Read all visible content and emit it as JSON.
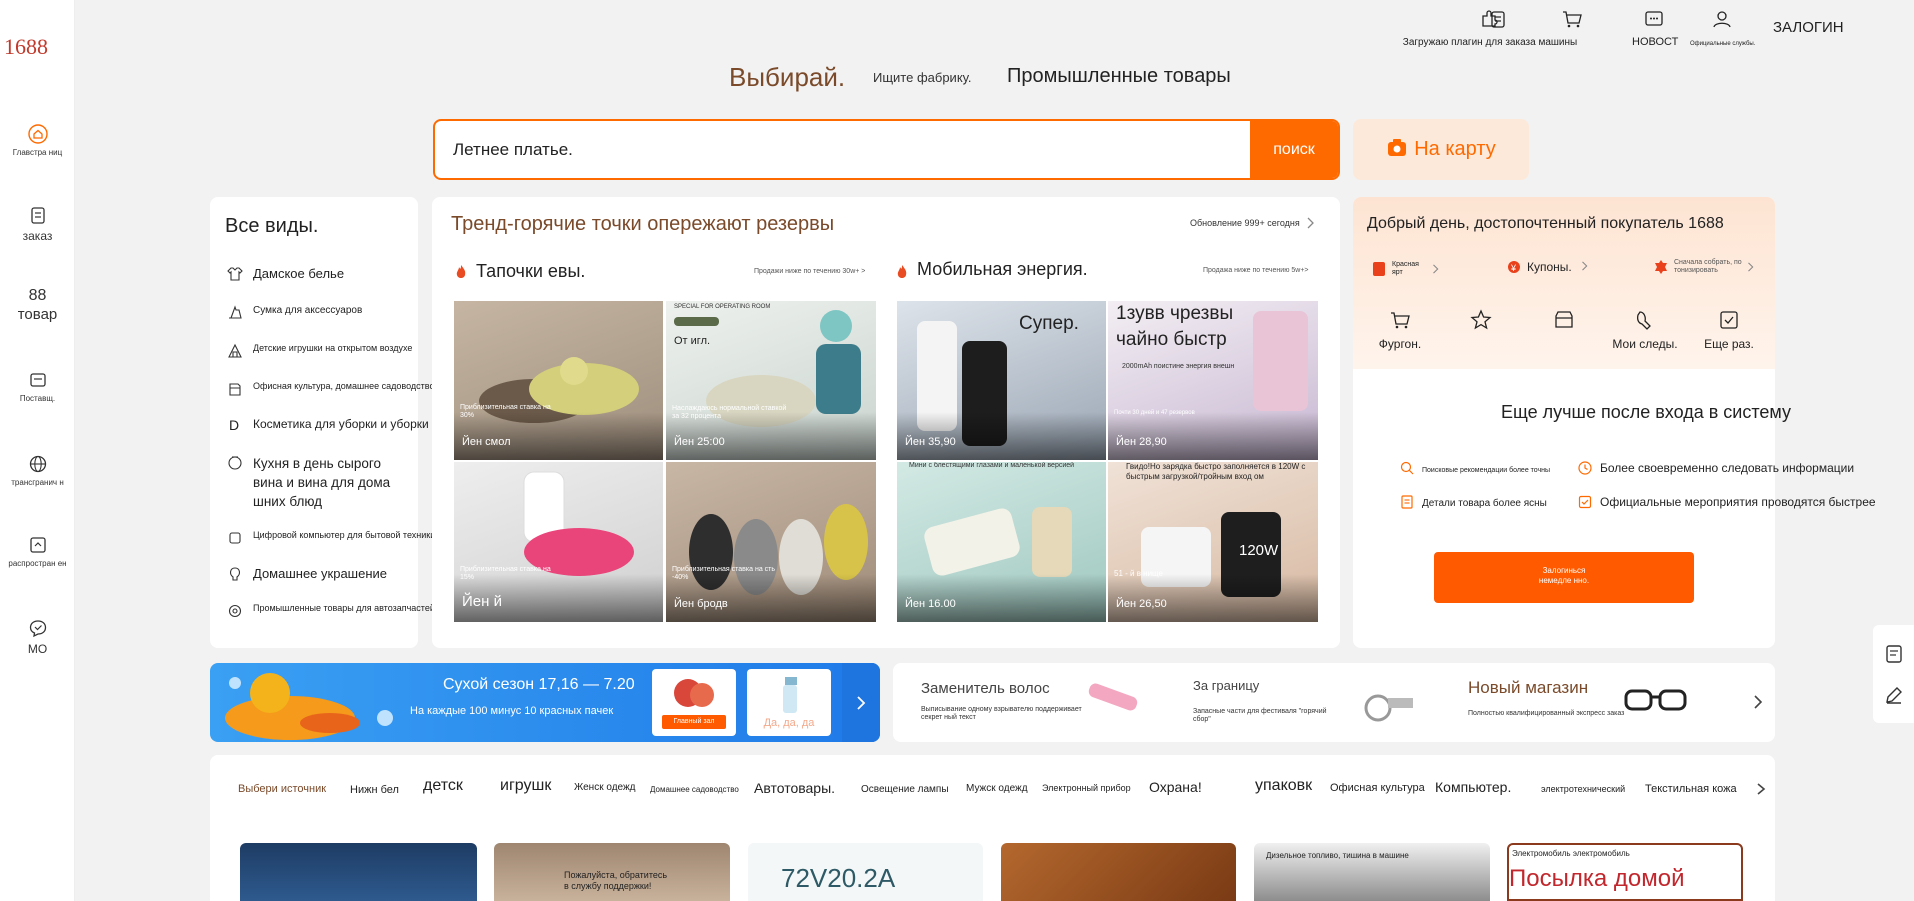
{
  "brand": {
    "logo": "1688"
  },
  "sidebar": {
    "items": [
      {
        "label": "Главстра ниц",
        "icon": "home-icon"
      },
      {
        "label": "заказ",
        "icon": "clipboard-icon"
      },
      {
        "num": "88",
        "label": "товар",
        "icon": "none"
      },
      {
        "label": "Поставщ.",
        "icon": "supplier-icon"
      },
      {
        "label": "трансгранич н",
        "icon": "globe-icon"
      },
      {
        "label": "распростран ен",
        "icon": "share-icon"
      },
      {
        "label": "МО",
        "icon": "chat-icon"
      }
    ]
  },
  "topnav": {
    "plugin": "Загружаю плагин для заказа машины",
    "news": "НОВОСТ",
    "official": "Официальные службы.",
    "login": "ЗАЛОГИН"
  },
  "header": {
    "brand_title": "Выбирай.",
    "factory": "Ищите фабрику.",
    "industrial": "Промышленные товары"
  },
  "search": {
    "value": "Летнее платье.",
    "button": "поиск",
    "map_button": "На карту"
  },
  "categories": {
    "title": "Все виды.",
    "items": [
      "Дамское белье",
      "Сумка для аксессуаров",
      "Детские игрушки на открытом воздухе",
      "Офисная культура, домашнее садоводство",
      "Косметика для уборки и уборки",
      "Кухня в день сырого вина и вина для дома шних блюд",
      "Цифровой компьютер для бытовой техники",
      "Домашнее украшение",
      "Промышленные товары для автозапчастей"
    ]
  },
  "trend": {
    "title": "Тренд-горячие точки опережают резервы",
    "update": "Обновление 999+ сегодня",
    "left": {
      "title": "Тапочки евы.",
      "note": "Продажи ниже по течению 30w+ >",
      "tiles": [
        {
          "caption": "Приблизительная ставка на 30%",
          "price": "Йен смол"
        },
        {
          "caption": "Наслаждаюсь нормальной ставкой за 32 процента",
          "price": "Йен 25:00",
          "tag": "SPECIAL FOR OPERATING ROOM",
          "extra": "От игл."
        },
        {
          "caption": "Приблизительная ставка на 15%",
          "price": "Йен й"
        },
        {
          "caption": "Приблизительная ставка на сть -40%",
          "price": "Йен бродв"
        }
      ]
    },
    "right": {
      "title": "Мобильная энергия.",
      "note": "Продажа ниже по течению 5w+>",
      "tiles": [
        {
          "big": "Супер.",
          "price": "Йен 35,90"
        },
        {
          "big": "1зувв чрезвы чайно быстр",
          "caption": "2000mAh поистине энергия внешн",
          "price": "Йен 28,90",
          "sub": "Почти 30 дней и 47 резервов"
        },
        {
          "caption": "Мини с блестящими глазами и маленькой версией",
          "price": "Йен 16.00"
        },
        {
          "caption": "Гвидо!Но зарядка быстро заполняется в 120W с быстрым загрузкой/тройным вход ом",
          "price": "Йен 26,50",
          "badge": "120W",
          "sub": "51 - й в нище"
        }
      ]
    }
  },
  "account": {
    "greeting": "Добрый день, достопочтенный покупатель 1688",
    "red_packet": "Красная ярт",
    "coupons": "Купоны.",
    "save": "Сначала собрать, по тонизировать",
    "actions": [
      "Фургон.",
      "",
      "",
      "Мои следы.",
      "Еще раз."
    ],
    "better": "Еще лучше после входа в систему",
    "features": [
      "Поисковые рекомендации более точны",
      "Более своевременно следовать информации",
      "Детали товара более ясны",
      "Официальные мероприятия проводятся быстрее"
    ],
    "login_btn": "Залогинься немедле нно."
  },
  "promo": {
    "title": "Сухой сезон 17,16 — 7.20",
    "subtitle": "На каждые 100 минус 10 красных пачек",
    "tag1": "Главный зал",
    "tag2": "Да, да, да"
  },
  "services": [
    {
      "title": "Заменитель волос",
      "desc": "Выписывание одному взрывателю поддерживает секрет ный текст"
    },
    {
      "title": "За границу",
      "desc": "Запасные части для фестиваля \"горячий сбор\""
    },
    {
      "title": "Новый магазин",
      "desc": "Полностью квалифицированный экспресс заказ"
    }
  ],
  "catbar": {
    "items": [
      "Выбери источник",
      "Нижн бел",
      "детск",
      "игрушк",
      "Женск одежд",
      "Домашнее садоводство",
      "Автотовары.",
      "Освещение лампы",
      "Мужск одежд",
      "Электронный прибор",
      "Охрана!",
      "упаковк",
      "Офисная культура",
      "Компьютер.",
      "электротехнический",
      "Текстильная кожа"
    ]
  },
  "products": [
    {
      "text": ""
    },
    {
      "text": "Пожалуйста, обратитесь в службу поддержки!"
    },
    {
      "text": "72V20.2A"
    },
    {
      "text": ""
    },
    {
      "text": "Дизельное топливо, тишина в машине"
    },
    {
      "text": "Посылка домой",
      "sub": "Электромобиль электромобиль"
    }
  ],
  "colors": {
    "accent": "#ff6a00",
    "brown": "#7a4a2a"
  }
}
